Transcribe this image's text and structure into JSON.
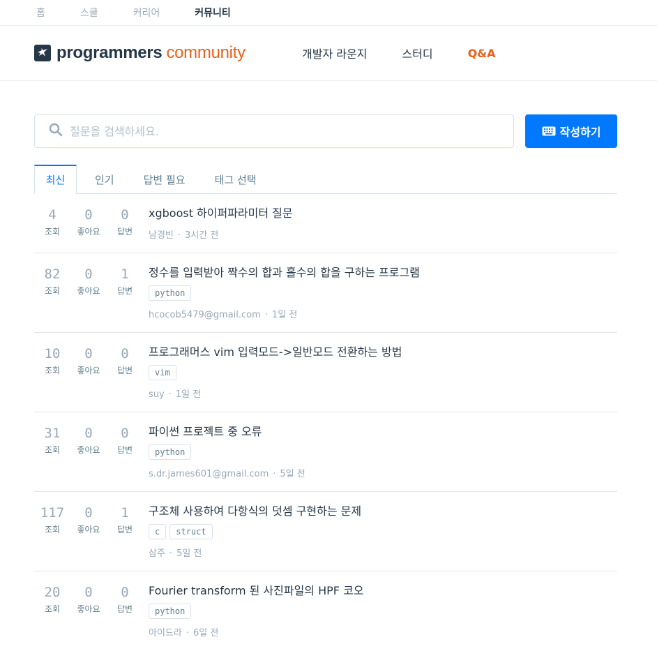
{
  "topnav": [
    "홈",
    "스쿨",
    "커리어",
    "커뮤니티"
  ],
  "brand": {
    "main": "programmers",
    "sub": "community"
  },
  "mainnav": [
    "개발자 라운지",
    "스터디",
    "Q&A"
  ],
  "search": {
    "placeholder": "질문을 검색하세요."
  },
  "write_button": "작성하기",
  "tabs": [
    "최신",
    "인기",
    "답변 필요",
    "태그 선택"
  ],
  "stat_labels": {
    "views": "조회",
    "likes": "좋아요",
    "answers": "답변"
  },
  "questions": [
    {
      "views": "4",
      "likes": "0",
      "answers": "0",
      "title": "xgboost 하이퍼파라미터 질문",
      "tags": [],
      "author": "남경빈",
      "time": "3시간 전"
    },
    {
      "views": "82",
      "likes": "0",
      "answers": "1",
      "title": "정수를 입력받아 짝수의 합과 홀수의 합을 구하는 프로그램",
      "tags": [
        "python"
      ],
      "author": "hcocob5479@gmail.com",
      "time": "1일 전"
    },
    {
      "views": "10",
      "likes": "0",
      "answers": "0",
      "title": "프로그래머스 vim 입력모드->일반모드 전환하는 방법",
      "tags": [
        "vim"
      ],
      "author": "suy",
      "time": "1일 전"
    },
    {
      "views": "31",
      "likes": "0",
      "answers": "0",
      "title": "파이썬 프로젝트 중 오류",
      "tags": [
        "python"
      ],
      "author": "s.dr.james601@gmail.com",
      "time": "5일 전"
    },
    {
      "views": "117",
      "likes": "0",
      "answers": "1",
      "title": "구조체 사용하여 다항식의 덧셈 구현하는 문제",
      "tags": [
        "c",
        "struct"
      ],
      "author": "삼주",
      "time": "5일 전"
    },
    {
      "views": "20",
      "likes": "0",
      "answers": "0",
      "title": "Fourier transform 된 사진파일의 HPF 코오",
      "tags": [
        "python"
      ],
      "author": "아이드라",
      "time": "6일 전"
    }
  ],
  "colors": {
    "accent": "#0078ff",
    "brand_orange": "#e8611b",
    "text": "#263747"
  }
}
